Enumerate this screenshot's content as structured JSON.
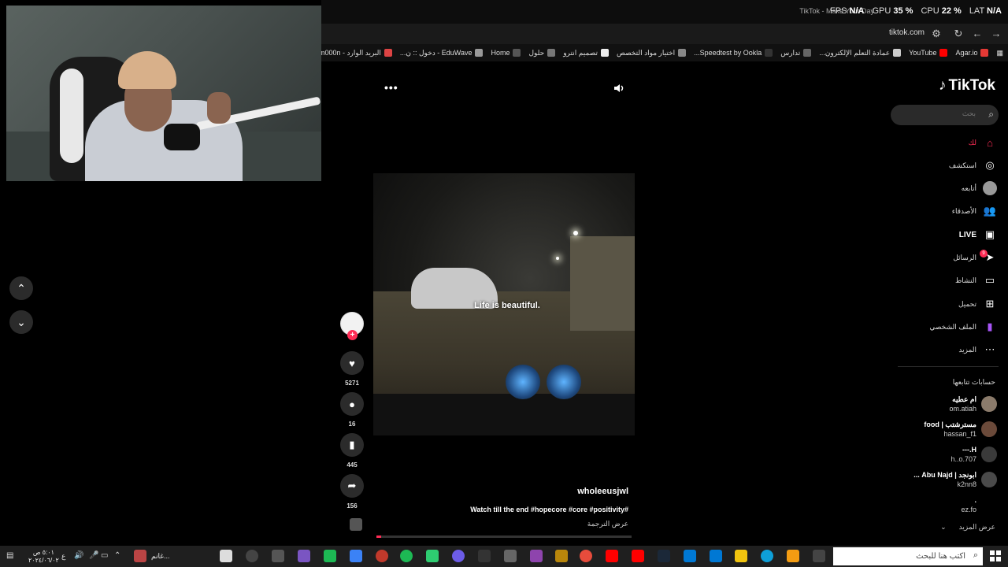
{
  "overlay": {
    "fps_label": "FPS",
    "fps_value": "N/A",
    "gpu_label": "GPU",
    "gpu_value": "35 %",
    "cpu_label": "CPU",
    "cpu_value": "22 %",
    "lat_label": "LAT",
    "lat_value": "N/A"
  },
  "browser": {
    "tab_title": "TikTok - Make Your Day",
    "url": "tiktok.com",
    "bookmarks": [
      {
        "label": "Agar.io"
      },
      {
        "label": "YouTube"
      },
      {
        "label": "عمادة التعلم الإلكترون..."
      },
      {
        "label": "تدارس"
      },
      {
        "label": "Speedtest by Ookla..."
      },
      {
        "label": "اختيار مواد التخصص"
      },
      {
        "label": "تصميم انترو"
      },
      {
        "label": "حلول"
      },
      {
        "label": "Home"
      },
      {
        "label": "EduWave - دخول :: ن..."
      },
      {
        "label": "البريد الوارد - m000n..."
      }
    ]
  },
  "video": {
    "subtitle": "Life is beautiful.",
    "author": "wholeeusjwl",
    "caption": "#Watch till the end #hopecore #core #positivity",
    "translate": "عرض الترجمة",
    "menu_glyph": "•••",
    "progress": 0.02
  },
  "actions": {
    "likes": "5271",
    "comments": "16",
    "saves": "445",
    "shares": "156"
  },
  "sidebar": {
    "logo": "TikTok",
    "search_placeholder": "بحث",
    "nav": {
      "home": "لك",
      "explore": "استكشف",
      "following": "أتابعه",
      "friends": "الأصدقاء",
      "live": "LIVE",
      "messages": "الرسائل",
      "messages_badge": "9",
      "activity": "النشاط",
      "upload": "تحميل",
      "profile": "الملف الشخصي",
      "more": "المزيد"
    },
    "following_title": "حسابات تتابعها",
    "accounts": [
      {
        "name": "ام عطيه",
        "handle": "om.atiah"
      },
      {
        "name": "مسترشتب | food",
        "handle": "hassan_f1"
      },
      {
        "name": "H.---",
        "handle": "h..o.707"
      },
      {
        "name": "ابونجد | Abu Najd ...",
        "handle": "k2nn8"
      },
      {
        "name": ".",
        "handle": "ez.fo"
      }
    ],
    "see_more": "عرض المزيد"
  },
  "taskbar": {
    "search_placeholder": "اكتب هنا للبحث",
    "time": "٥:٠١ ص",
    "date": "٢٠٢٤/٠٦/٠٢",
    "app_label": "غانم...",
    "lang": "ع"
  },
  "colors": {
    "accent": "#fe2c55",
    "background": "#000000"
  }
}
